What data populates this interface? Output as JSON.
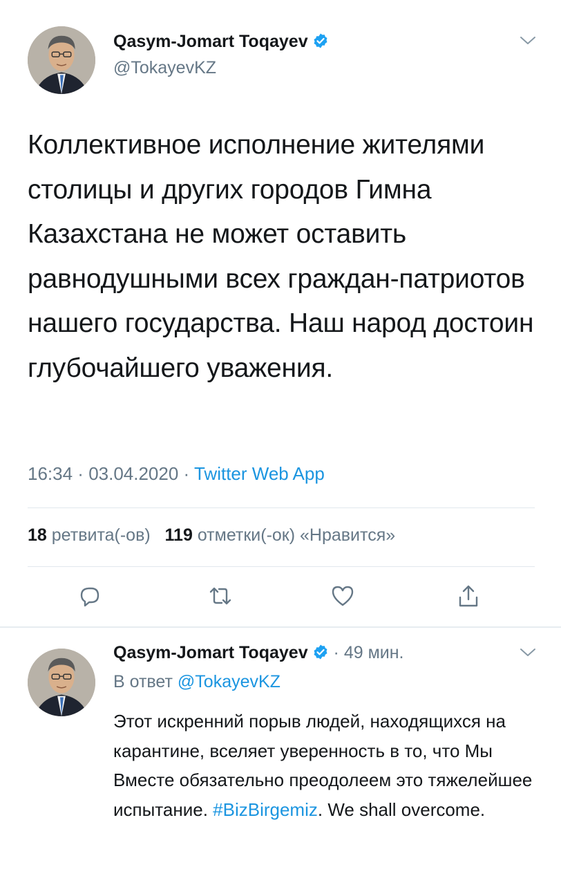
{
  "tweet": {
    "author_name": "Qasym-Jomart Toqayev",
    "author_handle": "@TokayevKZ",
    "text": "Коллективное исполнение жителями столицы и других городов Гимна Казахстана не может оставить равнодушными всех граждан-патриотов нашего государства. Наш народ достоин глубочайшего уважения.",
    "time": "16:34",
    "date": "03.04.2020",
    "meta_sep": " · ",
    "source": "Twitter Web App",
    "retweets_count": "18",
    "retweets_label": "ретвита(-ов)",
    "likes_count": "119",
    "likes_label": "отметки(-ок) «Нравится»"
  },
  "reply": {
    "author_name": "Qasym-Jomart Toqayev",
    "time_ago": "· 49 мин.",
    "reply_prefix": "В ответ",
    "reply_to": "@TokayevKZ",
    "text_main": "Этот искренний порыв людей, находящихся на карантине, вселяет уверенность в то, что Мы Вместе обязательно преодолеем это тяжелейшее испытание. ",
    "hashtag": "#BizBirgemiz",
    "text_end": ". We shall overcome."
  },
  "icons": {
    "verified": "verified-badge-icon",
    "chevron": "chevron-down-icon",
    "reply": "reply-icon",
    "retweet": "retweet-icon",
    "like": "heart-icon",
    "share": "share-icon"
  },
  "colors": {
    "text": "#14171a",
    "secondary": "#657786",
    "link": "#1b95e0",
    "divider": "#e1e8ed"
  }
}
